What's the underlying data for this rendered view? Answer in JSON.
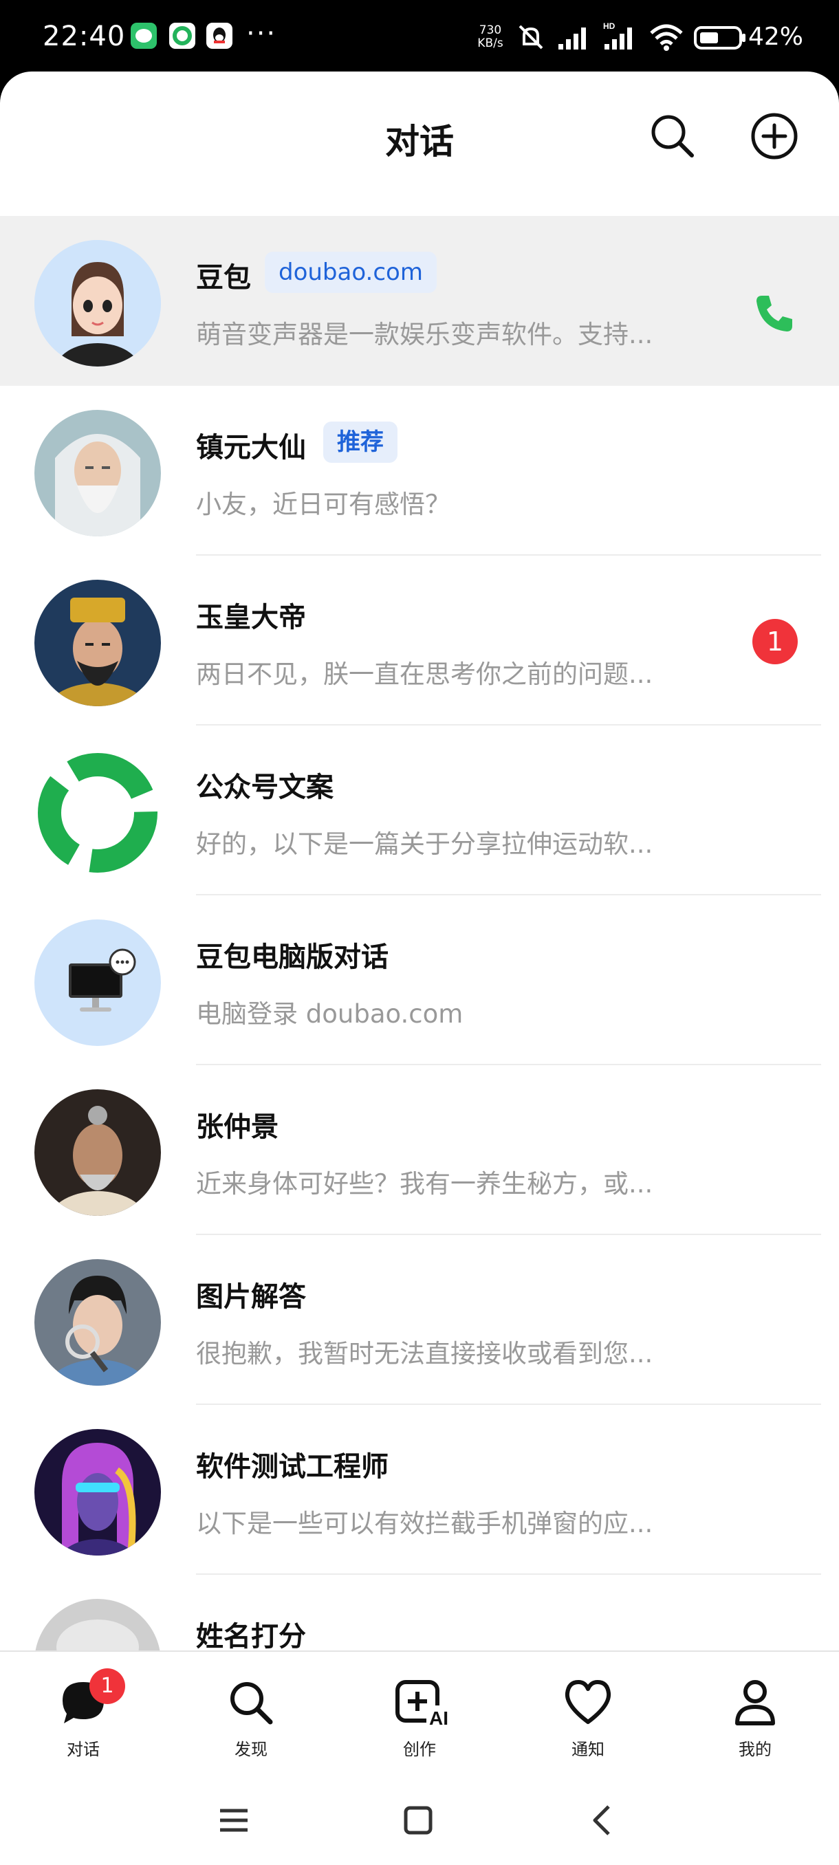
{
  "status_bar": {
    "time": "22:40",
    "notif_icons": [
      "wechat-icon",
      "doubao-green-icon",
      "qq-icon"
    ],
    "more": "···",
    "net_speed_value": "730",
    "net_speed_unit": "KB/s",
    "battery_percent": "42%"
  },
  "header": {
    "title": "对话",
    "search_icon": "search-icon",
    "add_icon": "plus-circle-icon"
  },
  "conversations": [
    {
      "name": "豆包",
      "tag": "doubao.com",
      "preview": "萌音变声器是一款娱乐变声软件。支持...",
      "trailing": "phone-icon",
      "color_trailing": "#2dbe5a"
    },
    {
      "name": "镇元大仙",
      "tag": "推荐",
      "preview": "小友，近日可有感悟？"
    },
    {
      "name": "玉皇大帝",
      "preview": "两日不见，朕一直在思考你之前的问题...",
      "unread": "1"
    },
    {
      "name": "公众号文案",
      "preview": "好的，以下是一篇关于分享拉伸运动软..."
    },
    {
      "name": "豆包电脑版对话",
      "preview": "电脑登录 doubao.com"
    },
    {
      "name": "张仲景",
      "preview": "近来身体可好些？我有一养生秘方，或..."
    },
    {
      "name": "图片解答",
      "preview": "很抱歉，我暂时无法直接接收或看到您..."
    },
    {
      "name": "软件测试工程师",
      "preview": "以下是一些可以有效拦截手机弹窗的应..."
    },
    {
      "name": "姓名打分",
      "preview": ""
    }
  ],
  "bottom_nav": [
    {
      "label": "对话",
      "icon": "chat-bubble-icon",
      "badge": "1"
    },
    {
      "label": "发现",
      "icon": "search-icon"
    },
    {
      "label": "创作",
      "icon": "ai-create-icon",
      "icon_text": "AI"
    },
    {
      "label": "通知",
      "icon": "heart-icon"
    },
    {
      "label": "我的",
      "icon": "person-icon"
    }
  ],
  "system_nav": [
    "menu-icon",
    "home-icon",
    "back-icon"
  ],
  "colors": {
    "accent": "#1f63d9",
    "tag_bg": "#e6eefb",
    "badge": "#f0333a",
    "call": "#2dbe5a"
  }
}
